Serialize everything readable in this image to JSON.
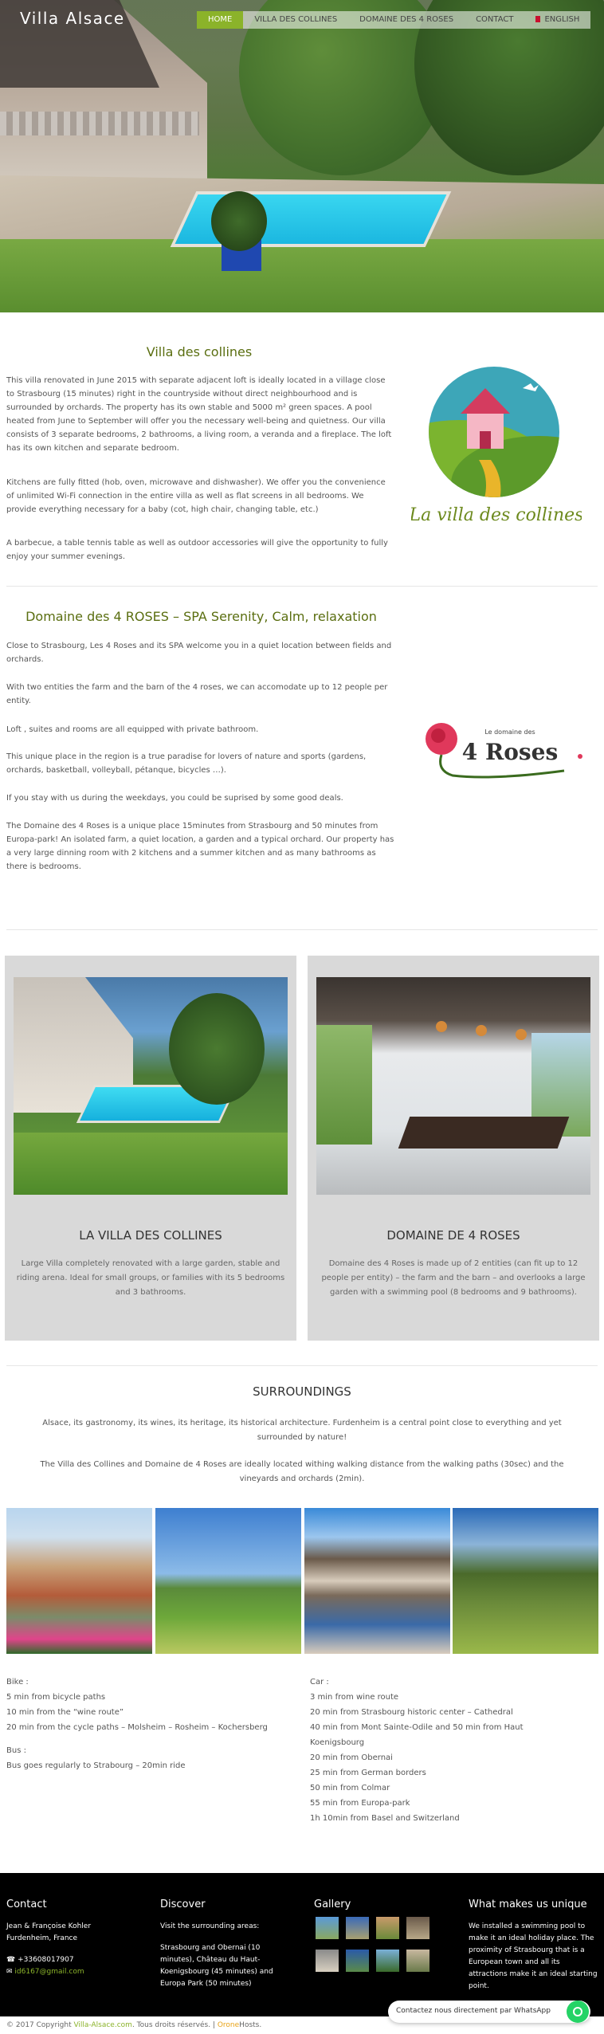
{
  "header": {
    "logo": "Villa Alsace",
    "nav": [
      {
        "label": "HOME",
        "active": true
      },
      {
        "label": "VILLA DES COLLINES",
        "active": false
      },
      {
        "label": "DOMAINE DES 4 ROSES",
        "active": false
      },
      {
        "label": "CONTACT",
        "active": false
      },
      {
        "label": "ENGLISH",
        "active": false
      }
    ]
  },
  "villa": {
    "title": "Villa des collines",
    "p1": "This villa renovated in June 2015 with separate adjacent loft is ideally located in a village close to Strasbourg (15 minutes) right in the countryside without direct neighbourhood and is surrounded by orchards. The property has its own stable and 5000 m² green spaces. A pool heated from June to September will offer you the necessary well-being and quietness. Our villa consists of 3 separate bedrooms, 2 bathrooms, a living room, a veranda and a fireplace. The loft has its own kitchen and separate bedroom.",
    "p2": "Kitchens are fully fitted (hob, oven, microwave and dishwasher). We offer you the convenience of unlimited Wi-Fi connection in the entire villa as well as flat screens in all bedrooms. We provide everything necessary for a baby (cot, high chair, changing table, etc.)",
    "p3": "A barbecue, a table tennis table as well as outdoor accessories will give the opportunity to fully enjoy your summer evenings.",
    "logo_text": "La villa des collines"
  },
  "domaine": {
    "title": "Domaine des 4 ROSES – SPA Serenity, Calm, relaxation",
    "p1": "Close to Strasbourg, Les 4 Roses and its SPA welcome you in a quiet location between fields and orchards.",
    "p2": "With two entities the farm and the barn of the 4 roses, we can accomodate up to 12 people per entity.",
    "p3": "Loft , suites and rooms are all equipped with private bathroom.",
    "p4": "This unique place in the region is a true paradise for lovers of nature and sports (gardens, orchards, basketball, volleyball, pétanque, bicycles …).",
    "p5": "If you stay with us during the weekdays, you could be suprised by some good deals.",
    "p6": "The Domaine des 4 Roses is a unique place 15minutes from Strasbourg and 50 minutes from Europa-park! An isolated farm, a quiet location, a garden and a typical orchard. Our property has a very large dinning room with 2 kitchens and a summer kitchen and as many bathrooms as there is bedrooms.",
    "logo_small": "Le domaine des",
    "logo_big": "4 Roses"
  },
  "cards": [
    {
      "title": "LA VILLA DES COLLINES",
      "desc": "Large Villa completely renovated with a large garden, stable and riding arena. Ideal for small groups, or families with its 5 bedrooms and 3 bathrooms."
    },
    {
      "title": "DOMAINE DE 4 ROSES",
      "desc": "Domaine des 4 Roses is made up of 2 entities (can fit up to 12 people per entity) – the farm and the barn – and overlooks a large garden with a swimming pool (8 bedrooms and 9 bathrooms)."
    }
  ],
  "surroundings": {
    "title": "SURROUNDINGS",
    "p1": "Alsace, its gastronomy, its wines, its heritage, its historical architecture. Furdenheim is a central point close to everything and yet surrounded by nature!",
    "p2": "The Villa des Collines and Domaine de 4 Roses are ideally located withing walking distance from the walking paths (30sec) and the vineyards and orchards (2min).",
    "bike_head": "Bike :",
    "bike": [
      "5 min from bicycle paths",
      "10 min from the “wine route”",
      "20 min from the cycle paths – Molsheim – Rosheim – Kochersberg"
    ],
    "bus_head": "Bus :",
    "bus": [
      "Bus goes regularly to Strabourg – 20min ride"
    ],
    "car_head": "Car :",
    "car": [
      "3 min from wine route",
      "20 min from Strasbourg historic center – Cathedral",
      "40 min from Mont Sainte-Odile and 50 min from Haut Koenigsbourg",
      "20 min from Obernai",
      "25 min from German borders",
      "50 min from Colmar",
      "55 min from Europa-park",
      "1h 10min from Basel and Switzerland"
    ]
  },
  "footer": {
    "contact_head": "Contact",
    "contact_name": "Jean & Françoise Kohler",
    "contact_city": "Furdenheim, France",
    "phone": "+33608017907",
    "email": "id6167@gmail.com",
    "discover_head": "Discover",
    "discover_intro": "Visit the surrounding areas:",
    "discover_body": "Strasbourg and Obernai (10 minutes), Château du Haut-Koenigsbourg (45 minutes) and Europa Park (50 minutes)",
    "gallery_head": "Gallery",
    "unique_head": "What makes us unique",
    "unique_body": "We installed a swimming pool to make it an ideal holiday place. The proximity of Strasbourg that is a European town and all its attractions make it an ideal starting point.",
    "copyright_pre": "© 2017 Copyright ",
    "copyright_link": "Villa-Alsace.com",
    "copyright_mid": ". Tous droits réservés. | ",
    "copyright_orange": "Orone",
    "copyright_end": "Hosts.",
    "whatsapp": "Contactez nous directement par WhatsApp"
  }
}
